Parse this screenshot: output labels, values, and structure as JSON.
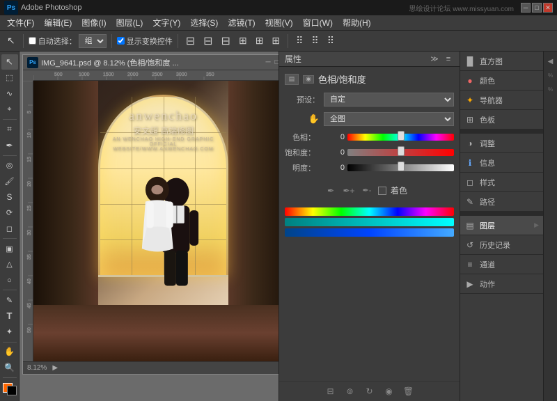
{
  "titlebar": {
    "title": "Adobe Photoshop",
    "ps_logo": "Ps",
    "watermark": "思绘设计论坛 www.missyuan.com",
    "btn_min": "─",
    "btn_max": "□",
    "btn_close": "✕"
  },
  "menubar": {
    "items": [
      "文件(F)",
      "编辑(E)",
      "图像(I)",
      "图层(L)",
      "文字(Y)",
      "选择(S)",
      "滤镜(T)",
      "视图(V)",
      "窗口(W)",
      "帮助(H)"
    ]
  },
  "toolbar": {
    "auto_select_label": "自动选择：",
    "group_label": "组",
    "show_transform_label": "显示变换控件",
    "checkbox_checked": true
  },
  "doc": {
    "title": "IMG_9641.psd @ 8.12% (色相/饱和度 ...",
    "zoom": "8.12%",
    "status_label": "8.12%"
  },
  "logo": {
    "main": "anwenchao",
    "cn": "安文超 高端修图",
    "sub": "AN WENCHAO HIGH-END GRAPHIC OFFICIAL WEBSITE/WWW.ANWENCHAO.COM"
  },
  "properties": {
    "header": "属性",
    "title": "色相/饱和度",
    "preset_label": "预设：",
    "preset_value": "自定",
    "channel_label": "",
    "channel_value": "全图",
    "hue_label": "色相：",
    "hue_value": "0",
    "sat_label": "饱和度：",
    "sat_value": "0",
    "light_label": "明度：",
    "light_value": "0",
    "colorize_label": "着色"
  },
  "right_panels": {
    "items": [
      {
        "label": "直方图",
        "icon": "■"
      },
      {
        "label": "颜色",
        "icon": "●"
      },
      {
        "label": "导航器",
        "icon": "◈"
      },
      {
        "label": "色板",
        "icon": "⊞"
      },
      {
        "label": "调整",
        "icon": "◑"
      },
      {
        "label": "信息",
        "icon": "ⓘ"
      },
      {
        "label": "样式",
        "icon": "◻"
      },
      {
        "label": "路径",
        "icon": "✎"
      },
      {
        "label": "图层",
        "icon": "▤",
        "active": true
      },
      {
        "label": "历史记录",
        "icon": "↺"
      },
      {
        "label": "通道",
        "icon": "≡"
      },
      {
        "label": "动作",
        "icon": "▶"
      }
    ]
  },
  "tools": {
    "items": [
      "↖",
      "⊹",
      "∠",
      "⬚",
      "✂",
      "✒",
      "S",
      "⌖",
      "🖌",
      "⟳",
      "A",
      "T",
      "✦",
      "🔍",
      "🖐",
      "□",
      "◎"
    ]
  }
}
